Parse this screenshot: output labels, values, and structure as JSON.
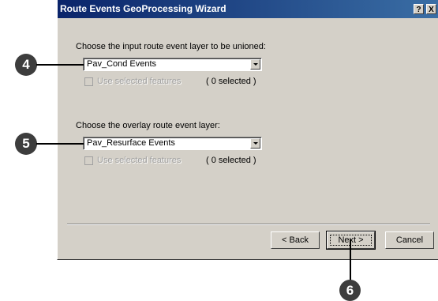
{
  "dialog": {
    "title": "Route Events GeoProcessing Wizard",
    "help_button": "?",
    "close_button": "X"
  },
  "input_section": {
    "prompt": "Choose the input route event layer to be unioned:",
    "layer_value": "Pav_Cond Events",
    "use_selected_label": "Use selected features",
    "selected_count": "( 0 selected )"
  },
  "overlay_section": {
    "prompt": "Choose the overlay route event layer:",
    "layer_value": "Pav_Resurface Events",
    "use_selected_label": "Use selected features",
    "selected_count": "( 0 selected )"
  },
  "buttons": {
    "back": "< Back",
    "next": "Next >",
    "cancel": "Cancel"
  },
  "callouts": {
    "step4": "4",
    "step5": "5",
    "step6": "6"
  },
  "colors": {
    "title_gradient_start": "#0a246a",
    "title_gradient_end": "#3a6ea5",
    "dialog_face": "#d4d0c8",
    "callout": "#3d3d3d"
  }
}
